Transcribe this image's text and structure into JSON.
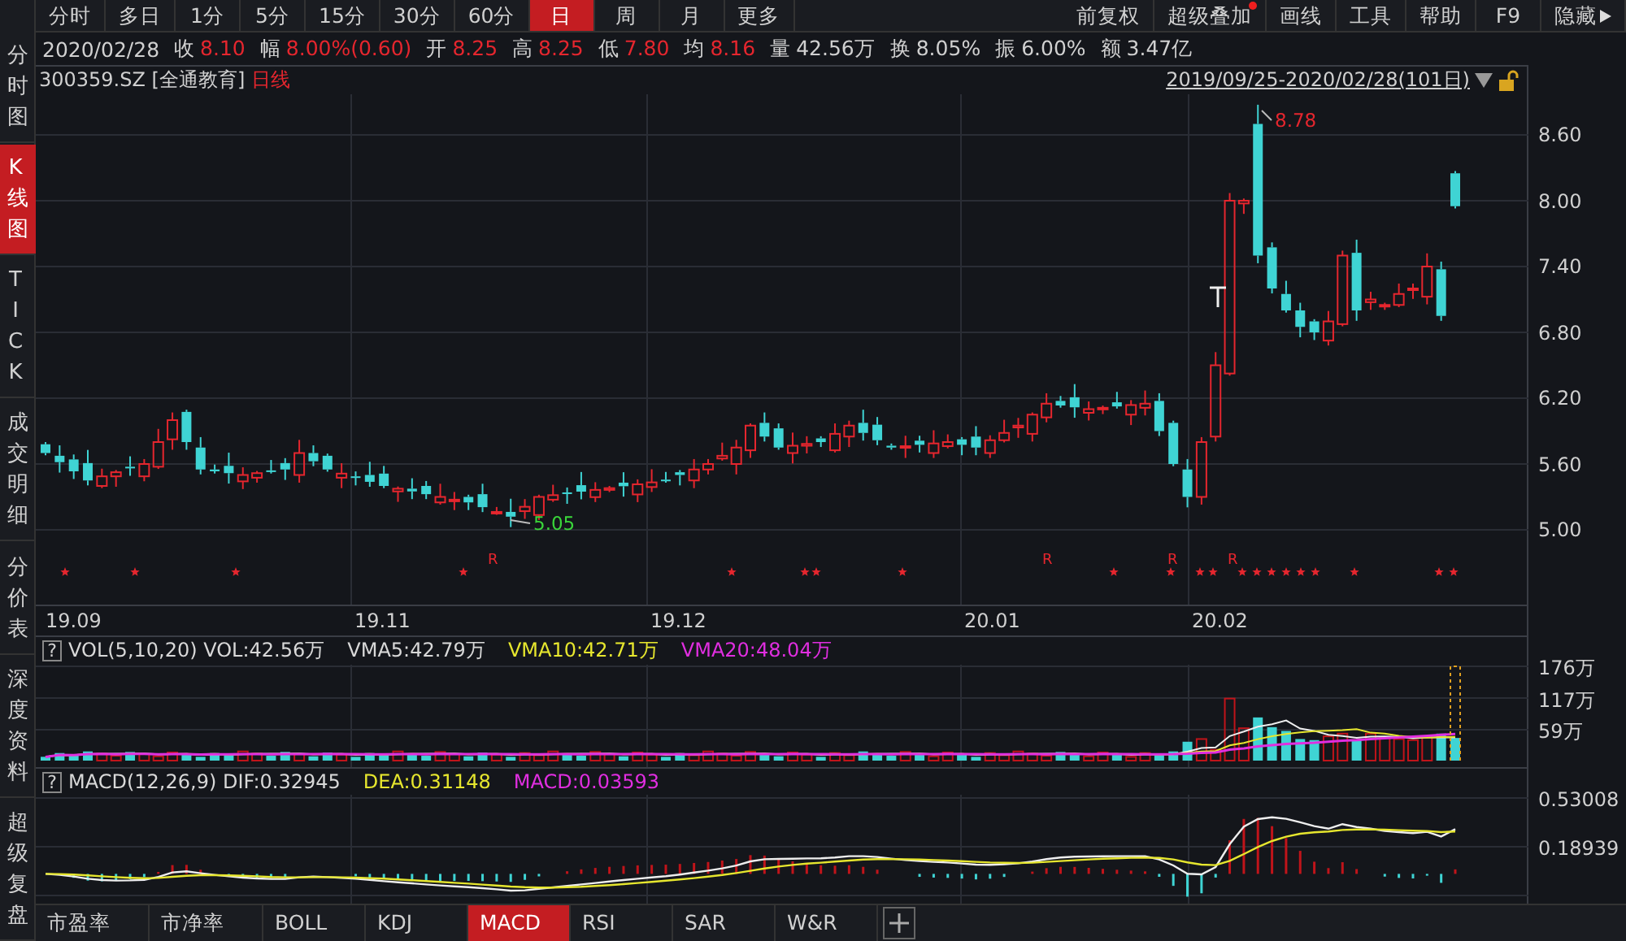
{
  "left_tabs": [
    {
      "label": "分时图",
      "selected": false
    },
    {
      "label": "K线图",
      "selected": true
    },
    {
      "label": "TICK",
      "selected": false
    },
    {
      "label": "成交明细",
      "selected": false
    },
    {
      "label": "分价表",
      "selected": false
    },
    {
      "label": "深度资料",
      "selected": false
    },
    {
      "label": "超级复盘",
      "selected": false
    }
  ],
  "period_tabs": [
    {
      "label": "分时",
      "selected": false
    },
    {
      "label": "多日",
      "selected": false
    },
    {
      "label": "1分",
      "selected": false
    },
    {
      "label": "5分",
      "selected": false
    },
    {
      "label": "15分",
      "selected": false
    },
    {
      "label": "30分",
      "selected": false
    },
    {
      "label": "60分",
      "selected": false
    },
    {
      "label": "日",
      "selected": true
    },
    {
      "label": "周",
      "selected": false
    },
    {
      "label": "月",
      "selected": false
    },
    {
      "label": "更多",
      "selected": false
    }
  ],
  "tool_buttons": [
    {
      "label": "前复权",
      "badge": false,
      "caret": false
    },
    {
      "label": "超级叠加",
      "badge": true,
      "caret": false
    },
    {
      "label": "画线",
      "badge": false,
      "caret": false
    },
    {
      "label": "工具",
      "badge": false,
      "caret": false
    },
    {
      "label": "帮助",
      "badge": false,
      "caret": false
    },
    {
      "label": "F9",
      "badge": false,
      "caret": false
    },
    {
      "label": "隐藏",
      "badge": false,
      "caret": true
    }
  ],
  "quote": {
    "date": "2020/02/28",
    "fields": [
      {
        "label": "收",
        "value": "8.10",
        "color": "#e5262e"
      },
      {
        "label": "幅",
        "value": "8.00%(0.60)",
        "color": "#e5262e"
      },
      {
        "label": "开",
        "value": "8.25",
        "color": "#e5262e"
      },
      {
        "label": "高",
        "value": "8.25",
        "color": "#e5262e"
      },
      {
        "label": "低",
        "value": "7.80",
        "color": "#e5262e"
      },
      {
        "label": "均",
        "value": "8.16",
        "color": "#e5262e"
      },
      {
        "label": "量",
        "value": "42.56万",
        "color": "#d0d0d0"
      },
      {
        "label": "换",
        "value": "8.05%",
        "color": "#d0d0d0"
      },
      {
        "label": "振",
        "value": "6.00%",
        "color": "#d0d0d0"
      },
      {
        "label": "额",
        "value": "3.47亿",
        "color": "#d0d0d0"
      }
    ]
  },
  "chart": {
    "symbol": "300359.SZ",
    "name": "[全通教育]",
    "period": "日线",
    "range": "2019/09/25-2020/02/28(101日)",
    "price_ticks": [
      "8.60",
      "8.00",
      "7.40",
      "6.80",
      "6.20",
      "5.60",
      "5.00"
    ],
    "date_ticks": [
      "19.09",
      "19.11",
      "19.12",
      "20.01",
      "20.02"
    ],
    "annotations": [
      {
        "text": "8.78",
        "color": "#e5262e"
      },
      {
        "text": "5.05",
        "color": "#3ad63a"
      }
    ],
    "r_marks": [
      "R",
      "R",
      "R",
      "R"
    ]
  },
  "volume": {
    "help": "?",
    "legend": [
      {
        "text": "VOL(5,10,20) VOL:42.56万",
        "color": "#d8d8d8"
      },
      {
        "text": "VMA5:42.79万",
        "color": "#d8d8d8"
      },
      {
        "text": "VMA10:42.71万",
        "color": "#e6e62e"
      },
      {
        "text": "VMA20:48.04万",
        "color": "#e02ee0"
      }
    ],
    "ticks": [
      "176万",
      "117万",
      "59万"
    ]
  },
  "macd": {
    "help": "?",
    "legend": [
      {
        "text": "MACD(12,26,9) DIF:0.32945",
        "color": "#d8d8d8"
      },
      {
        "text": "DEA:0.31148",
        "color": "#e6e62e"
      },
      {
        "text": "MACD:0.03593",
        "color": "#e02ee0"
      }
    ],
    "ticks": [
      "0.53008",
      "0.18939"
    ]
  },
  "indicator_tabs": [
    {
      "label": "市盈率",
      "selected": false
    },
    {
      "label": "市净率",
      "selected": false
    },
    {
      "label": "BOLL",
      "selected": false
    },
    {
      "label": "KDJ",
      "selected": false
    },
    {
      "label": "MACD",
      "selected": true
    },
    {
      "label": "RSI",
      "selected": false
    },
    {
      "label": "SAR",
      "selected": false
    },
    {
      "label": "W&R",
      "selected": false
    }
  ]
}
